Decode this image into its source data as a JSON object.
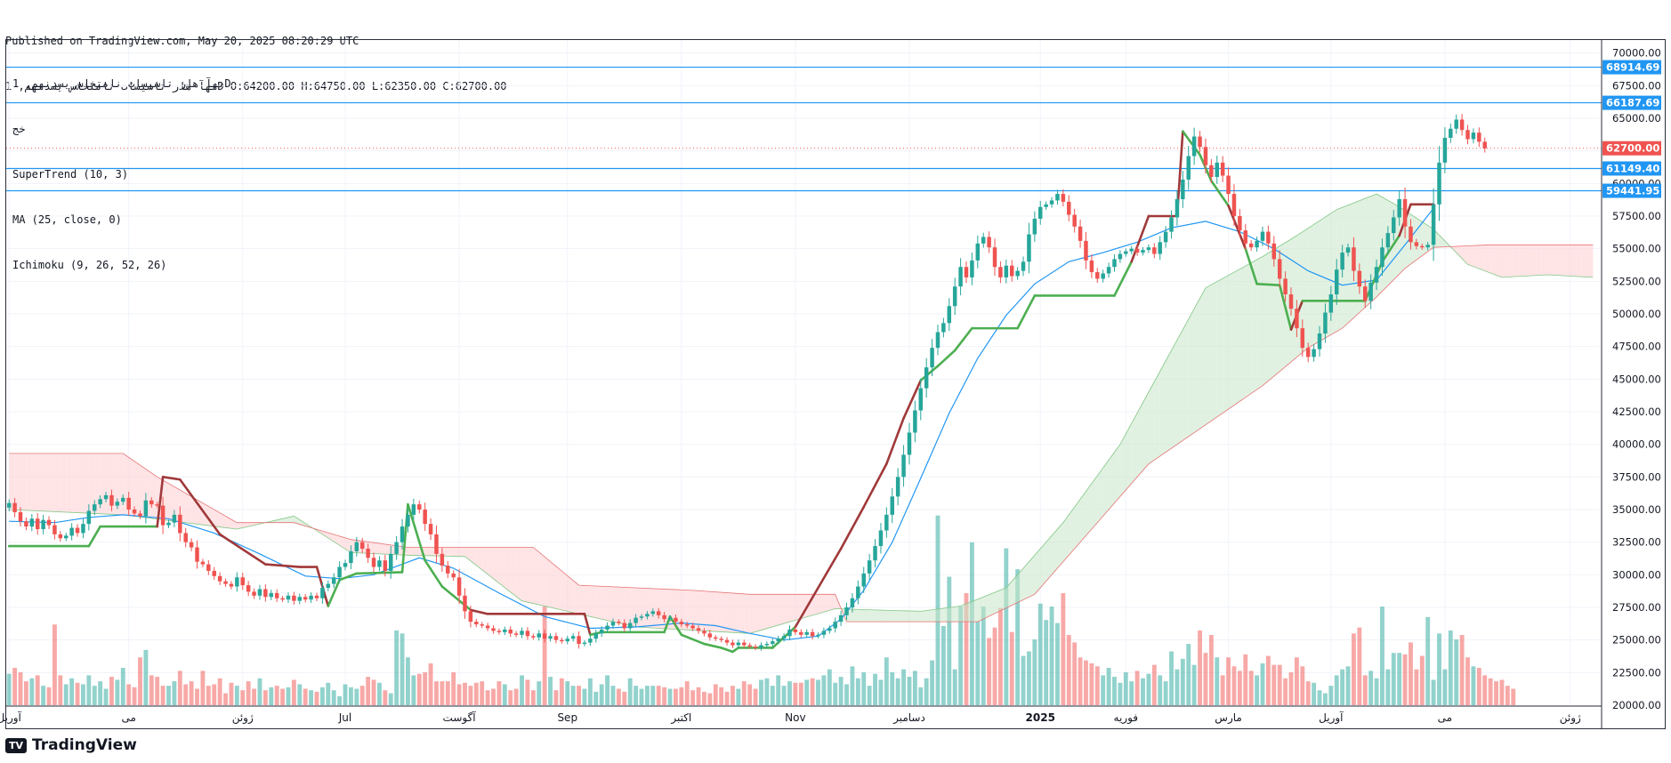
{
  "header": {
    "published": "Published on TradingView.com, May 20, 2025 08:20:29 UTC",
    "ohlc_line": "نهآ هار تاسیسات نامتخاس یسدنهم, 1D O:64200.00 H:64750.00 L:62350.00 C:62700.00"
  },
  "legend": {
    "symbol": "نهآ هار تاسیسات نامتخاس یسدنهم, 1D",
    "extra": "خج",
    "supertrend": "SuperTrend (10, 3)",
    "ma": "MA (25, close, 0)",
    "ichimoku": "Ichimoku (9, 26, 52, 26)"
  },
  "brand": {
    "name": "TradingView",
    "logo_text": "TV"
  },
  "colors": {
    "up": "#26a69a",
    "down": "#ef5350",
    "supertrend": "#4caf50",
    "ma": "#2196f3",
    "conversion": "#a0393a",
    "cloud_up": "#c8e6c9",
    "cloud_down": "#ffcdd2",
    "hline": "#2196f3",
    "price_tag": "#ef5350"
  },
  "chart_data": {
    "type": "candlestick",
    "ylim": [
      20000,
      71000
    ],
    "y_ticks": [
      "70000.00",
      "67500.00",
      "65000.00",
      "62500.00",
      "60000.00",
      "57500.00",
      "55000.00",
      "52500.00",
      "50000.00",
      "47500.00",
      "45000.00",
      "42500.00",
      "40000.00",
      "37500.00",
      "35000.00",
      "32500.00",
      "30000.00",
      "27500.00",
      "25000.00",
      "22500.00",
      "20000.00"
    ],
    "x_labels": [
      {
        "label": "آوریل",
        "i": 0
      },
      {
        "label": "می",
        "i": 21
      },
      {
        "label": "ژوئن",
        "i": 41
      },
      {
        "label": "Jul",
        "i": 59
      },
      {
        "label": "آگوست",
        "i": 79
      },
      {
        "label": "Sep",
        "i": 98
      },
      {
        "label": "اکتبر",
        "i": 118
      },
      {
        "label": "Nov",
        "i": 138
      },
      {
        "label": "دسامبر",
        "i": 158
      },
      {
        "label": "2025",
        "i": 181
      },
      {
        "label": "فوریه",
        "i": 196
      },
      {
        "label": "مارس",
        "i": 214
      },
      {
        "label": "آوریل",
        "i": 232
      },
      {
        "label": "می",
        "i": 252
      },
      {
        "label": "ژوئن",
        "i": 274
      }
    ],
    "n_slots": 280,
    "last_price": "62700.00",
    "horizontal_levels": [
      "68914.69",
      "66187.69",
      "61149.40",
      "59441.95"
    ],
    "closes": [
      35500,
      34800,
      34100,
      33700,
      34300,
      33500,
      34200,
      33800,
      33100,
      32800,
      33000,
      33600,
      33200,
      33900,
      34900,
      35400,
      35800,
      36100,
      35300,
      35600,
      35900,
      35000,
      34700,
      34500,
      35700,
      35400,
      35300,
      33800,
      34000,
      34600,
      33200,
      32500,
      32100,
      31000,
      30800,
      30300,
      29900,
      29500,
      29300,
      29100,
      29800,
      29200,
      28700,
      28400,
      28900,
      28300,
      28600,
      28200,
      28100,
      28400,
      28000,
      28300,
      28100,
      28400,
      28200,
      29000,
      29300,
      29800,
      30600,
      30900,
      31800,
      32500,
      32000,
      31300,
      30600,
      31100,
      30300,
      31600,
      32500,
      33700,
      34600,
      35400,
      35000,
      33900,
      33100,
      31600,
      30700,
      30100,
      29800,
      28400,
      27200,
      26400,
      26200,
      26100,
      25900,
      25700,
      25600,
      25800,
      25500,
      25400,
      25700,
      25300,
      25200,
      25500,
      25100,
      25300,
      25000,
      24900,
      25100,
      25300,
      24700,
      24800,
      25100,
      25500,
      25800,
      26100,
      26400,
      26300,
      25900,
      26300,
      26700,
      26800,
      27000,
      27200,
      26900,
      26600,
      26700,
      26400,
      26200,
      26100,
      25900,
      25700,
      25500,
      25200,
      25100,
      25000,
      24800,
      24600,
      24800,
      24600,
      24500,
      24400,
      24600,
      24700,
      24900,
      25100,
      25300,
      25800,
      25600,
      25400,
      25600,
      25300,
      25400,
      25700,
      25900,
      26400,
      26900,
      27500,
      28200,
      29100,
      30100,
      31100,
      32200,
      33400,
      34600,
      36000,
      37500,
      39200,
      40900,
      42600,
      44300,
      45900,
      47400,
      48600,
      49300,
      50600,
      52100,
      53600,
      52800,
      54100,
      55400,
      55900,
      55100,
      53600,
      52800,
      53700,
      52900,
      53300,
      54000,
      56100,
      57300,
      58200,
      58400,
      58700,
      59200,
      58600,
      57600,
      56700,
      55600,
      54100,
      53200,
      52700,
      53100,
      53600,
      54200,
      54600,
      54800,
      55000,
      54700,
      54900,
      55100,
      54600,
      55500,
      56300,
      57400,
      58800,
      60300,
      62100,
      63600,
      62800,
      61400,
      60500,
      61600,
      60600,
      59200,
      57500,
      56400,
      55400,
      55100,
      55600,
      56300,
      55400,
      54200,
      52700,
      51500,
      50400,
      48900,
      47400,
      46700,
      47300,
      48500,
      50100,
      51500,
      53400,
      54700,
      55100,
      53300,
      52100,
      51000,
      52400,
      53600,
      55100,
      56200,
      57400,
      58800,
      56700,
      55500,
      55200,
      55100,
      55300,
      58400,
      61600,
      63500,
      64200,
      64900,
      64100,
      63400,
      63900,
      63200,
      62700
    ],
    "volumes": [
      2.1,
      2.5,
      2.2,
      1.6,
      1.8,
      2.0,
      1.3,
      1.2,
      5.4,
      2.0,
      1.4,
      1.8,
      1.5,
      1.4,
      2.0,
      1.3,
      1.6,
      1.1,
      1.9,
      1.7,
      2.5,
      1.4,
      1.2,
      3.2,
      3.7,
      2.0,
      1.9,
      1.3,
      1.3,
      1.6,
      2.3,
      1.4,
      1.6,
      1.1,
      2.3,
      1.3,
      1.4,
      1.8,
      0.8,
      1.5,
      1.3,
      1.0,
      1.6,
      1.1,
      1.8,
      1.0,
      1.2,
      1.3,
      1.1,
      1.2,
      1.7,
      1.4,
      1.1,
      1.0,
      0.9,
      1.2,
      1.5,
      1.0,
      0.6,
      1.4,
      1.2,
      1.1,
      1.3,
      1.9,
      1.7,
      1.5,
      1.0,
      0.8,
      5.0,
      4.8,
      3.2,
      2.0,
      2.1,
      2.2,
      2.8,
      1.6,
      1.6,
      1.6,
      2.2,
      1.4,
      1.5,
      1.3,
      1.5,
      1.6,
      1.0,
      1.1,
      1.6,
      1.4,
      1.0,
      1.1,
      2.0,
      1.7,
      1.0,
      1.6,
      6.6,
      1.9,
      1.0,
      1.8,
      1.6,
      1.3,
      1.3,
      1.1,
      1.8,
      0.9,
      1.4,
      2.0,
      1.3,
      1.1,
      0.9,
      1.8,
      1.3,
      1.1,
      1.3,
      1.3,
      1.3,
      1.2,
      1.1,
      1.1,
      1.2,
      1.6,
      1.0,
      1.2,
      0.9,
      0.8,
      1.4,
      1.2,
      0.9,
      1.3,
      1.1,
      1.6,
      1.4,
      1.1,
      1.7,
      1.8,
      1.3,
      2.0,
      1.3,
      1.6,
      1.5,
      1.5,
      1.7,
      1.8,
      1.7,
      2.0,
      2.4,
      1.5,
      1.9,
      1.4,
      2.6,
      1.8,
      2.2,
      1.3,
      2.1,
      1.7,
      3.2,
      2.2,
      1.8,
      2.4,
      1.9,
      2.3,
      1.2,
      1.8,
      3.0,
      12.7,
      5.3,
      8.6,
      2.4,
      6.6,
      7.5,
      10.9,
      5.6,
      6.6,
      4.5,
      5.2,
      6.5,
      10.5,
      4.9,
      9.1,
      3.3,
      3.6,
      4.4,
      6.8,
      5.7,
      6.6,
      5.5,
      7.5,
      4.7,
      4.2,
      3.2,
      3.0,
      2.8,
      2.6,
      2.0,
      2.5,
      1.9,
      1.5,
      2.2,
      1.6,
      2.3,
      1.8,
      2.1,
      2.7,
      2.0,
      1.6,
      3.6,
      2.4,
      3.1,
      4.1,
      2.7,
      5.0,
      3.5,
      4.7,
      3.2,
      2.0,
      3.2,
      2.6,
      2.3,
      3.4,
      2.3,
      2.0,
      2.8,
      3.3,
      2.7,
      2.7,
      1.8,
      2.2,
      3.2,
      2.6,
      1.6,
      1.5,
      1.0,
      0.8,
      1.3,
      2.0,
      2.4,
      2.6,
      4.8,
      5.2,
      2.0,
      2.3,
      1.8,
      6.6,
      2.4,
      3.5,
      3.5,
      3.4,
      4.2,
      2.4,
      3.3,
      5.9,
      1.7,
      4.8,
      2.4,
      5.0,
      4.4,
      4.7,
      3.2,
      2.6,
      2.5,
      2.0,
      1.8,
      1.6,
      1.7,
      1.3,
      1.1
    ],
    "supertrend": [
      {
        "i": 0,
        "v": 32200
      },
      {
        "i": 14,
        "v": 32200
      },
      {
        "i": 16,
        "v": 33700
      },
      {
        "i": 26,
        "v": 33700
      },
      {
        "i": 27,
        "v": 37500
      },
      {
        "i": 30,
        "v": 37300
      },
      {
        "i": 37,
        "v": 33100
      },
      {
        "i": 45,
        "v": 30800
      },
      {
        "i": 51,
        "v": 30600
      },
      {
        "i": 54,
        "v": 30600
      },
      {
        "i": 56,
        "v": 27600
      },
      {
        "i": 58,
        "v": 29600
      },
      {
        "i": 61,
        "v": 30100
      },
      {
        "i": 69,
        "v": 30200
      },
      {
        "i": 70,
        "v": 35400
      },
      {
        "i": 73,
        "v": 31100
      },
      {
        "i": 76,
        "v": 29100
      },
      {
        "i": 81,
        "v": 27300
      },
      {
        "i": 84,
        "v": 27000
      },
      {
        "i": 101,
        "v": 27000
      },
      {
        "i": 102,
        "v": 25400
      },
      {
        "i": 104,
        "v": 25600
      },
      {
        "i": 115,
        "v": 25600
      },
      {
        "i": 116,
        "v": 26800
      },
      {
        "i": 118,
        "v": 25400
      },
      {
        "i": 122,
        "v": 24700
      },
      {
        "i": 125,
        "v": 24400
      },
      {
        "i": 127,
        "v": 24100
      },
      {
        "i": 128,
        "v": 24400
      },
      {
        "i": 134,
        "v": 24400
      },
      {
        "i": 138,
        "v": 26000
      },
      {
        "i": 142,
        "v": 29000
      },
      {
        "i": 146,
        "v": 32000
      },
      {
        "i": 150,
        "v": 35200
      },
      {
        "i": 154,
        "v": 38500
      },
      {
        "i": 157,
        "v": 42000
      },
      {
        "i": 160,
        "v": 44900
      },
      {
        "i": 163,
        "v": 46000
      },
      {
        "i": 166,
        "v": 47200
      },
      {
        "i": 169,
        "v": 48900
      },
      {
        "i": 177,
        "v": 48900
      },
      {
        "i": 180,
        "v": 51400
      },
      {
        "i": 194,
        "v": 51400
      },
      {
        "i": 197,
        "v": 54000
      },
      {
        "i": 200,
        "v": 57500
      },
      {
        "i": 205,
        "v": 57500
      },
      {
        "i": 206,
        "v": 64000
      },
      {
        "i": 209,
        "v": 62200
      },
      {
        "i": 211,
        "v": 60200
      },
      {
        "i": 214,
        "v": 58300
      },
      {
        "i": 217,
        "v": 55000
      },
      {
        "i": 219,
        "v": 52300
      },
      {
        "i": 223,
        "v": 52200
      },
      {
        "i": 225,
        "v": 48800
      },
      {
        "i": 227,
        "v": 51000
      },
      {
        "i": 238,
        "v": 51000
      },
      {
        "i": 241,
        "v": 54000
      },
      {
        "i": 244,
        "v": 56000
      },
      {
        "i": 246,
        "v": 58400
      },
      {
        "i": 250,
        "v": 58400
      }
    ],
    "ma": [
      {
        "i": 0,
        "v": 34100
      },
      {
        "i": 8,
        "v": 34000
      },
      {
        "i": 14,
        "v": 34400
      },
      {
        "i": 20,
        "v": 34600
      },
      {
        "i": 28,
        "v": 34300
      },
      {
        "i": 36,
        "v": 33200
      },
      {
        "i": 44,
        "v": 31600
      },
      {
        "i": 52,
        "v": 29900
      },
      {
        "i": 58,
        "v": 29700
      },
      {
        "i": 64,
        "v": 30000
      },
      {
        "i": 72,
        "v": 31300
      },
      {
        "i": 78,
        "v": 30500
      },
      {
        "i": 86,
        "v": 28600
      },
      {
        "i": 94,
        "v": 26800
      },
      {
        "i": 102,
        "v": 25900
      },
      {
        "i": 110,
        "v": 26000
      },
      {
        "i": 118,
        "v": 26300
      },
      {
        "i": 124,
        "v": 26100
      },
      {
        "i": 130,
        "v": 25500
      },
      {
        "i": 136,
        "v": 25000
      },
      {
        "i": 142,
        "v": 25300
      },
      {
        "i": 146,
        "v": 26600
      },
      {
        "i": 150,
        "v": 28800
      },
      {
        "i": 155,
        "v": 32500
      },
      {
        "i": 160,
        "v": 37400
      },
      {
        "i": 165,
        "v": 42400
      },
      {
        "i": 170,
        "v": 46600
      },
      {
        "i": 175,
        "v": 49900
      },
      {
        "i": 180,
        "v": 52300
      },
      {
        "i": 186,
        "v": 54000
      },
      {
        "i": 192,
        "v": 54700
      },
      {
        "i": 198,
        "v": 55500
      },
      {
        "i": 204,
        "v": 56600
      },
      {
        "i": 210,
        "v": 57100
      },
      {
        "i": 216,
        "v": 56300
      },
      {
        "i": 222,
        "v": 55000
      },
      {
        "i": 228,
        "v": 53300
      },
      {
        "i": 234,
        "v": 52200
      },
      {
        "i": 240,
        "v": 52600
      },
      {
        "i": 245,
        "v": 55300
      },
      {
        "i": 250,
        "v": 58100
      }
    ],
    "cloud_a": [
      {
        "i": 0,
        "v": 35000
      },
      {
        "i": 20,
        "v": 34600
      },
      {
        "i": 40,
        "v": 33500
      },
      {
        "i": 50,
        "v": 34500
      },
      {
        "i": 60,
        "v": 31700
      },
      {
        "i": 70,
        "v": 31500
      },
      {
        "i": 80,
        "v": 31400
      },
      {
        "i": 90,
        "v": 28000
      },
      {
        "i": 110,
        "v": 26000
      },
      {
        "i": 130,
        "v": 25500
      },
      {
        "i": 145,
        "v": 27400
      },
      {
        "i": 160,
        "v": 27200
      },
      {
        "i": 167,
        "v": 27600
      },
      {
        "i": 175,
        "v": 29000
      },
      {
        "i": 185,
        "v": 34000
      },
      {
        "i": 195,
        "v": 40000
      },
      {
        "i": 200,
        "v": 44000
      },
      {
        "i": 210,
        "v": 52000
      },
      {
        "i": 220,
        "v": 54400
      },
      {
        "i": 226,
        "v": 56000
      },
      {
        "i": 233,
        "v": 58000
      },
      {
        "i": 240,
        "v": 59200
      },
      {
        "i": 244,
        "v": 58200
      },
      {
        "i": 250,
        "v": 56500
      },
      {
        "i": 256,
        "v": 53800
      },
      {
        "i": 262,
        "v": 52800
      },
      {
        "i": 270,
        "v": 53000
      },
      {
        "i": 278,
        "v": 52800
      }
    ],
    "cloud_b": [
      {
        "i": 0,
        "v": 39300
      },
      {
        "i": 20,
        "v": 39300
      },
      {
        "i": 26,
        "v": 37500
      },
      {
        "i": 40,
        "v": 34000
      },
      {
        "i": 50,
        "v": 34000
      },
      {
        "i": 60,
        "v": 32700
      },
      {
        "i": 70,
        "v": 32100
      },
      {
        "i": 80,
        "v": 32100
      },
      {
        "i": 92,
        "v": 32100
      },
      {
        "i": 100,
        "v": 29200
      },
      {
        "i": 110,
        "v": 29000
      },
      {
        "i": 120,
        "v": 28800
      },
      {
        "i": 130,
        "v": 28500
      },
      {
        "i": 145,
        "v": 28500
      },
      {
        "i": 147,
        "v": 26400
      },
      {
        "i": 170,
        "v": 26400
      },
      {
        "i": 180,
        "v": 28500
      },
      {
        "i": 190,
        "v": 33500
      },
      {
        "i": 200,
        "v": 38500
      },
      {
        "i": 210,
        "v": 41500
      },
      {
        "i": 220,
        "v": 44500
      },
      {
        "i": 228,
        "v": 47400
      },
      {
        "i": 234,
        "v": 48900
      },
      {
        "i": 240,
        "v": 51300
      },
      {
        "i": 245,
        "v": 53500
      },
      {
        "i": 250,
        "v": 55100
      },
      {
        "i": 260,
        "v": 55300
      },
      {
        "i": 278,
        "v": 55300
      }
    ]
  }
}
